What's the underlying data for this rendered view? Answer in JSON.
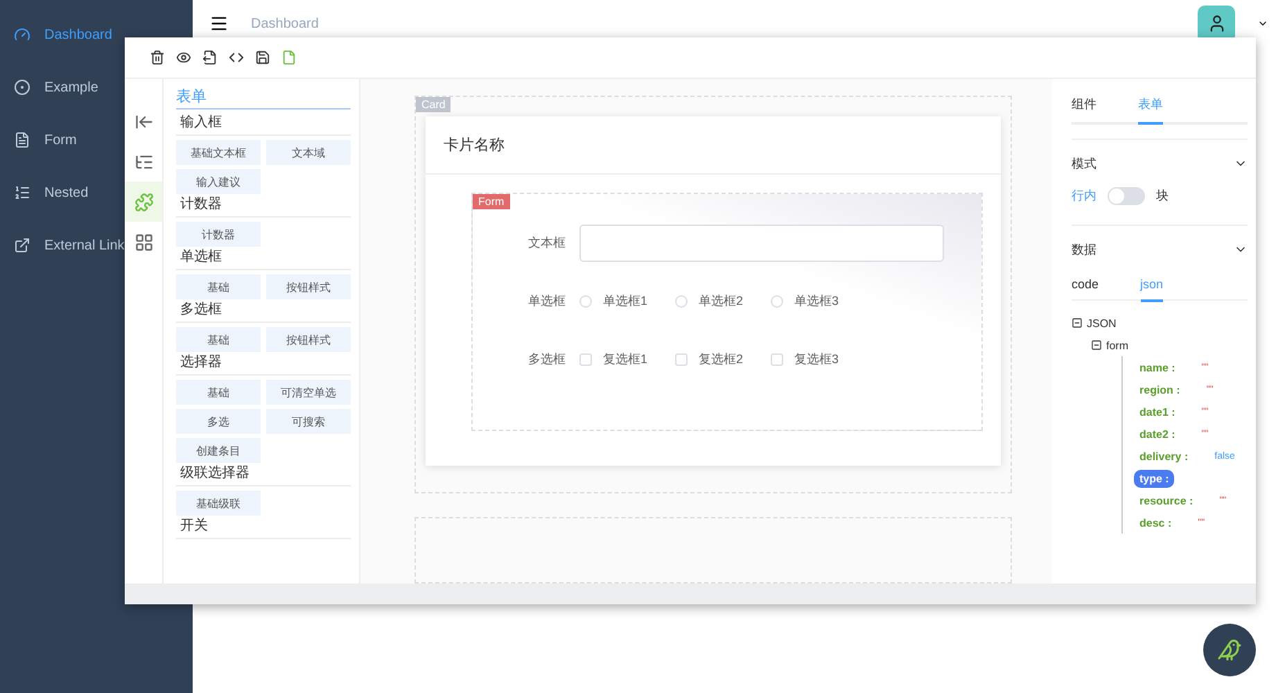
{
  "sidebar": {
    "items": [
      {
        "label": "Dashboard",
        "selected": true
      },
      {
        "label": "Example",
        "selected": false
      },
      {
        "label": "Form",
        "selected": false
      },
      {
        "label": "Nested",
        "selected": false
      },
      {
        "label": "External Link",
        "selected": false
      }
    ]
  },
  "header": {
    "breadcrumb": "Dashboard"
  },
  "dialog": {
    "side_tabs": [
      {
        "selected": false
      },
      {
        "selected": false
      },
      {
        "selected": true
      },
      {
        "selected": false
      }
    ],
    "palette": {
      "title": "表单",
      "groups": [
        {
          "title": "输入框",
          "items": [
            "基础文本框",
            "文本域",
            "输入建议"
          ]
        },
        {
          "title": "计数器",
          "items": [
            "计数器"
          ]
        },
        {
          "title": "单选框",
          "items": [
            "基础",
            "按钮样式"
          ]
        },
        {
          "title": "多选框",
          "items": [
            "基础",
            "按钮样式"
          ]
        },
        {
          "title": "选择器",
          "items": [
            "基础",
            "可清空单选",
            "多选",
            "可搜索",
            "创建条目"
          ]
        },
        {
          "title": "级联选择器",
          "items": [
            "基础级联"
          ]
        },
        {
          "title": "开关"
        }
      ]
    },
    "canvas": {
      "card_tag": "Card",
      "card_title": "卡片名称",
      "form_tag": "Form",
      "fields": [
        {
          "kind": "input",
          "label": "文本框"
        },
        {
          "kind": "radio",
          "label": "单选框",
          "options": [
            {
              "label": "单选框1",
              "checked": false
            },
            {
              "label": "单选框2",
              "checked": false
            },
            {
              "label": "单选框3",
              "checked": false
            }
          ]
        },
        {
          "kind": "checkbox",
          "label": "多选框",
          "options": [
            {
              "label": "复选框1",
              "checked": false
            },
            {
              "label": "复选框2",
              "checked": false
            },
            {
              "label": "复选框3",
              "checked": false
            }
          ]
        }
      ]
    },
    "panel": {
      "tabs": [
        {
          "label": "组件",
          "selected": false
        },
        {
          "label": "表单",
          "selected": true
        }
      ],
      "mode": {
        "title": "模式",
        "expanded": true,
        "left": "行内",
        "right": "块",
        "on": false
      },
      "data": {
        "title": "数据",
        "expanded": true,
        "tabs": [
          {
            "label": "code",
            "selected": false
          },
          {
            "label": "json",
            "selected": true
          }
        ],
        "tree": {
          "label": "JSON",
          "expanded": true,
          "children": [
            {
              "label": "form",
              "expanded": true,
              "children": [
                {
                  "key": "name :",
                  "value": "\"\"",
                  "kind": "string",
                  "selected": false
                },
                {
                  "key": "region :",
                  "value": "\"\"",
                  "kind": "string",
                  "selected": false
                },
                {
                  "key": "date1 :",
                  "value": "\"\"",
                  "kind": "string",
                  "selected": false
                },
                {
                  "key": "date2 :",
                  "value": "\"\"",
                  "kind": "string",
                  "selected": false
                },
                {
                  "key": "delivery :",
                  "value": "false",
                  "kind": "boolean",
                  "selected": false
                },
                {
                  "key": "type :",
                  "kind": "none",
                  "selected": true
                },
                {
                  "key": "resource :",
                  "value": "\"\"",
                  "kind": "string",
                  "selected": false
                },
                {
                  "key": "desc :",
                  "value": "\"\"",
                  "kind": "string",
                  "selected": false
                }
              ]
            }
          ]
        }
      }
    }
  }
}
